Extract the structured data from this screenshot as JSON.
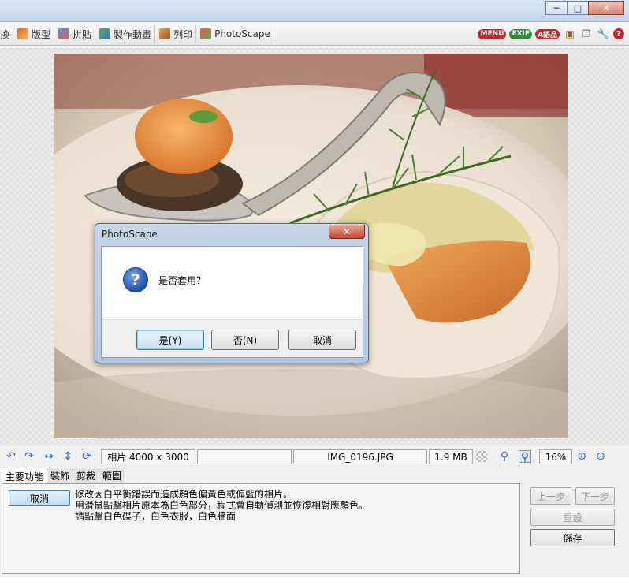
{
  "nav": {
    "tabs": [
      {
        "label": "版型",
        "icon": "layout-icon"
      },
      {
        "label": "拼貼",
        "icon": "combine-icon"
      },
      {
        "label": "製作動畫",
        "icon": "gif-animation-icon"
      },
      {
        "label": "列印",
        "icon": "print-icon"
      },
      {
        "label": "PhotoScape",
        "icon": "photoscape-icon"
      }
    ],
    "partial_left": "換"
  },
  "toolbar": {
    "menu_label": "MENU",
    "exif_label": "EXIF",
    "lang_label": "A語品"
  },
  "window": {
    "minimize": "─",
    "maximize": "□",
    "close": "✕"
  },
  "dialog": {
    "title": "PhotoScape",
    "message": "是否套用？",
    "yes": "是(Y)",
    "no": "否(N)",
    "cancel": "取消",
    "close": "✕"
  },
  "status": {
    "dimensions": "相片 4000 x 3000",
    "filename": "IMG_0196.JPG",
    "filesize": "1.9 MB",
    "zoom": "16%"
  },
  "panel": {
    "tabs": [
      "主要功能",
      "裝飾",
      "剪裁",
      "範圍"
    ],
    "active_tab": "主要功能",
    "cancel_label": "取消",
    "description": [
      "修改因白平衡錯誤而造成顏色偏黃色或偏藍的相片。",
      "用滑鼠點擊相片原本為白色部分，程式會自動偵測並恢復相對應顏色。",
      "請點擊白色碟子，白色衣服，白色牆面"
    ],
    "undo_label": "上一步",
    "redo_label": "下一步",
    "reset_label": "重設",
    "save_label": "儲存"
  }
}
